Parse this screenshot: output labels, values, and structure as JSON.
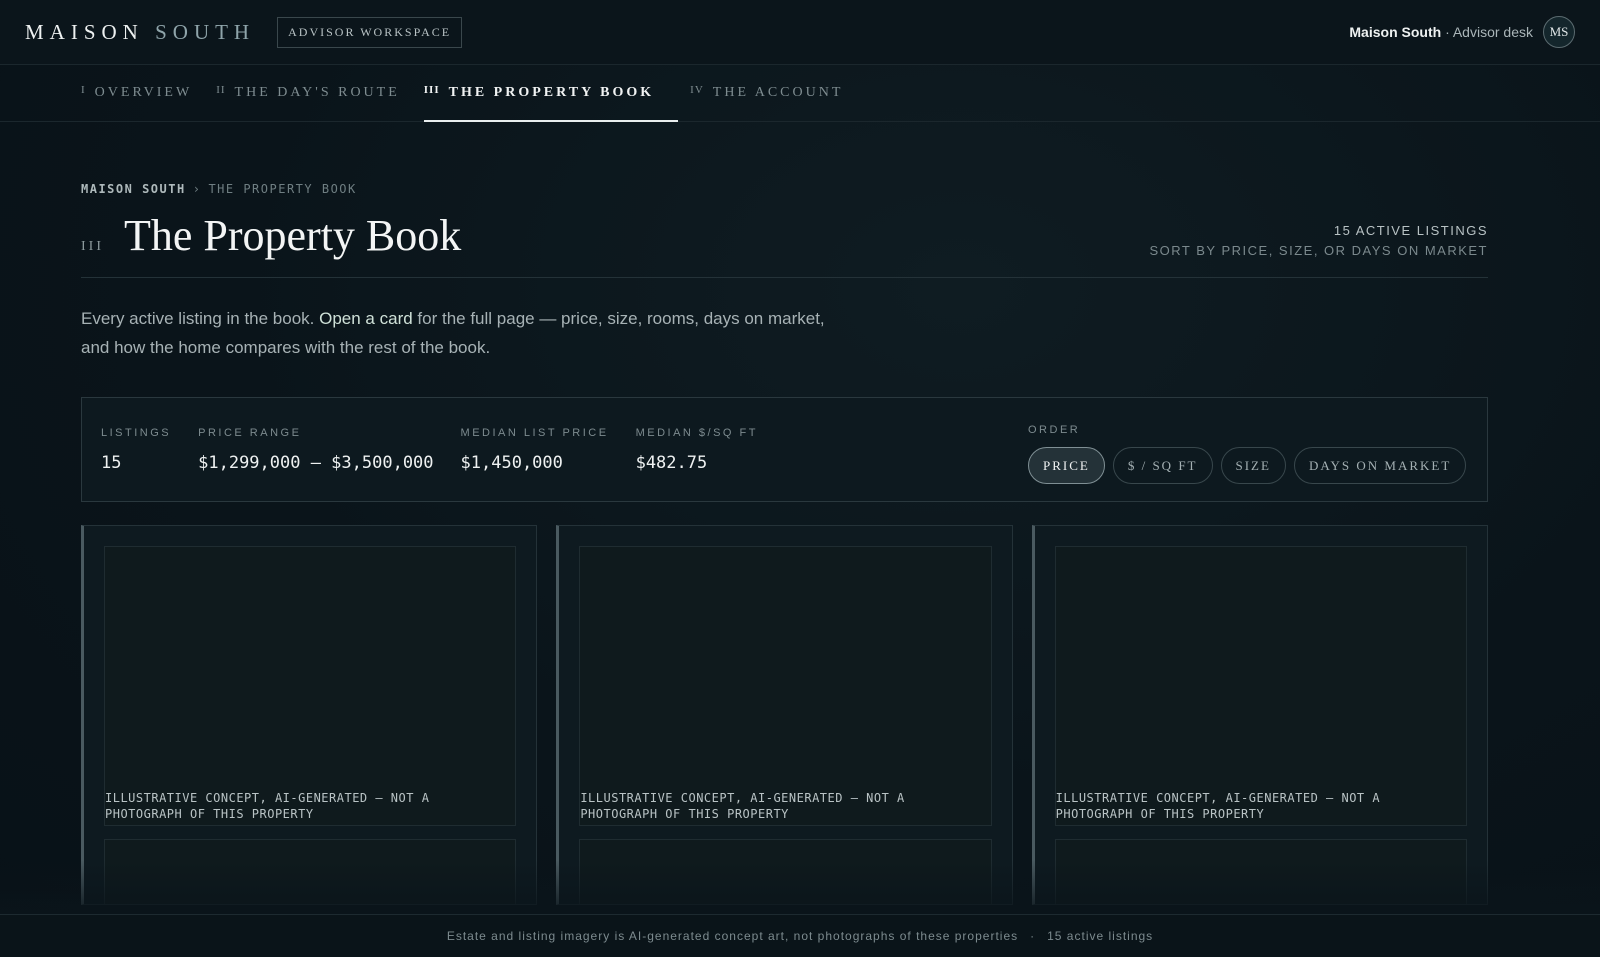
{
  "brand": {
    "maison": "MAISON",
    "south": "SOUTH",
    "workspace": "ADVISOR WORKSPACE"
  },
  "account": {
    "name": "Maison South",
    "role": "· Advisor desk",
    "initials": "MS"
  },
  "tabs": [
    {
      "num": "I",
      "label": "OVERVIEW"
    },
    {
      "num": "II",
      "label": "THE DAY'S ROUTE"
    },
    {
      "num": "III",
      "label": "THE PROPERTY BOOK"
    },
    {
      "num": "IV",
      "label": "THE ACCOUNT"
    }
  ],
  "breadcrumb": {
    "root": "MAISON SOUTH",
    "sep": "›",
    "current": "THE PROPERTY BOOK"
  },
  "page": {
    "num": "III",
    "title": "The Property Book",
    "count": "15 ACTIVE LISTINGS",
    "hint": "SORT BY PRICE, SIZE, OR DAYS ON MARKET",
    "intro_a": "Every active listing in the book. ",
    "intro_link": "Open a card",
    "intro_b": " for the full page — price, size, rooms, days on market, and how the home compares with the rest of the book."
  },
  "stats": [
    {
      "label": "LISTINGS",
      "value": "15"
    },
    {
      "label": "PRICE RANGE",
      "value": "$1,299,000 – $3,500,000"
    },
    {
      "label": "MEDIAN LIST PRICE",
      "value": "$1,450,000"
    },
    {
      "label": "MEDIAN $/SQ FT",
      "value": "$482.75"
    }
  ],
  "order": {
    "label": "ORDER",
    "options": [
      "PRICE",
      "$ / SQ FT",
      "SIZE",
      "DAYS ON MARKET"
    ],
    "selected": "PRICE"
  },
  "cards": [
    {
      "caption": "ILLUSTRATIVE CONCEPT, AI-GENERATED — NOT A PHOTOGRAPH OF THIS PROPERTY"
    },
    {
      "caption": "ILLUSTRATIVE CONCEPT, AI-GENERATED — NOT A PHOTOGRAPH OF THIS PROPERTY"
    },
    {
      "caption": "ILLUSTRATIVE CONCEPT, AI-GENERATED — NOT A PHOTOGRAPH OF THIS PROPERTY"
    }
  ],
  "footer": {
    "note": "Estate and listing imagery is AI-generated concept art, not photographs of these properties",
    "dot": "·",
    "count": "15 active listings"
  }
}
